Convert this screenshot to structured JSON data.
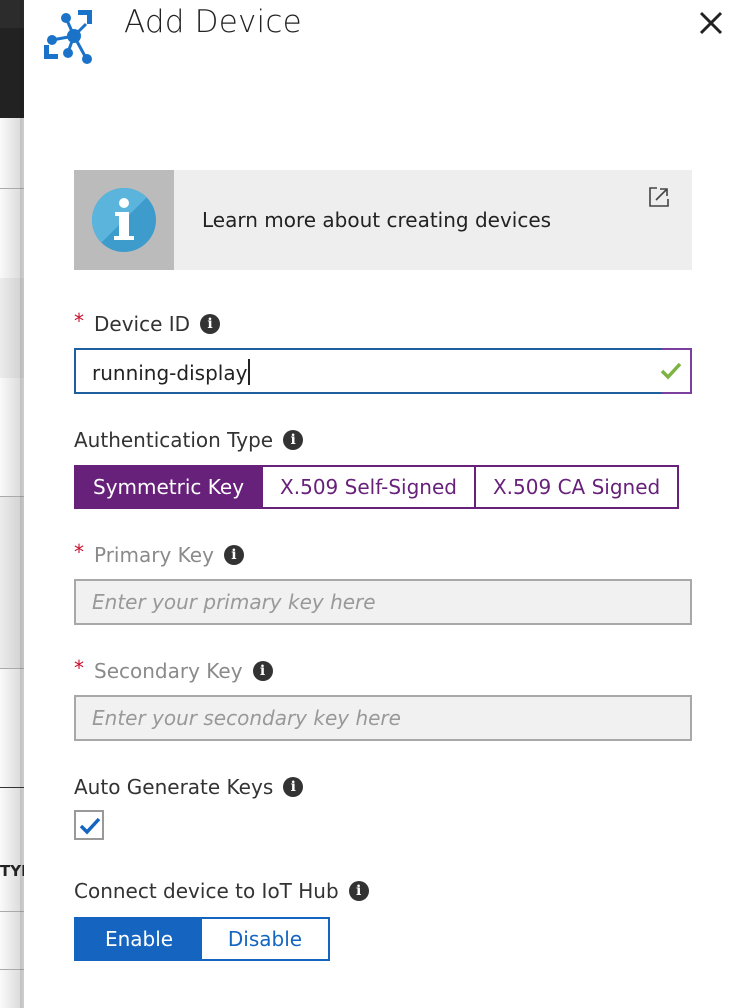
{
  "panel": {
    "title": "Add Device",
    "close_label": "Close"
  },
  "background": {
    "truncated_text": "TYI"
  },
  "info_banner": {
    "text": "Learn more about creating devices",
    "icon": "info-icon",
    "link_icon": "external-link-icon"
  },
  "device_id": {
    "label": "Device ID",
    "required": "*",
    "value": "running-display",
    "valid": true
  },
  "auth_type": {
    "label": "Authentication Type",
    "options": [
      "Symmetric Key",
      "X.509 Self-Signed",
      "X.509 CA Signed"
    ],
    "selected": "Symmetric Key"
  },
  "primary_key": {
    "label": "Primary Key",
    "required": "*",
    "placeholder": "Enter your primary key here",
    "value": ""
  },
  "secondary_key": {
    "label": "Secondary Key",
    "required": "*",
    "placeholder": "Enter your secondary key here",
    "value": ""
  },
  "auto_generate": {
    "label": "Auto Generate Keys",
    "checked": true
  },
  "connect_hub": {
    "label": "Connect device to IoT Hub",
    "options": [
      "Enable",
      "Disable"
    ],
    "selected": "Enable"
  },
  "colors": {
    "accent_purple": "#68217a",
    "accent_blue": "#1565c0",
    "required_red": "#c8102e",
    "valid_green": "#7cb342",
    "icon_blue": "#1a73c8"
  },
  "info_glyph": "i"
}
